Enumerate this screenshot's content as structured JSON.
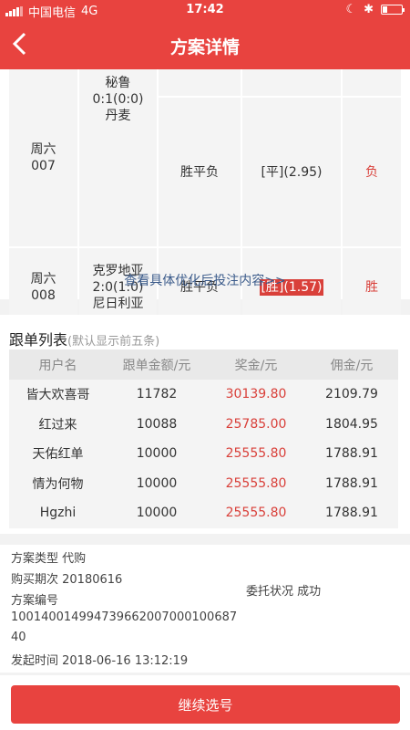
{
  "status_bar": {
    "carrier": "中国电信",
    "network": "4G",
    "time": "17:42"
  },
  "nav": {
    "title": "方案详情"
  },
  "matches": [
    {
      "day": "周六",
      "num": "007",
      "home": "秘鲁",
      "score": "0:1(0:0)",
      "away": "丹麦",
      "play": "胜平负",
      "pick_label": "[平]",
      "pick_odds": "(2.95)",
      "result": "负",
      "pick_highlight": false
    },
    {
      "day": "周六",
      "num": "008",
      "home": "克罗地亚",
      "score": "2:0(1:0)",
      "away": "尼日利亚",
      "play": "胜平负",
      "pick_label": "[胜]",
      "pick_odds": "(1.57)",
      "result": "胜",
      "pick_highlight": true
    }
  ],
  "see_more_link": "查看具体优化后投注内容>>",
  "follow": {
    "title": "跟单列表",
    "subtitle": "(默认显示前五条)",
    "headers": [
      "用户名",
      "跟单金额/元",
      "奖金/元",
      "佣金/元"
    ],
    "rows": [
      [
        "皆大欢喜哥",
        "11782",
        "30139.80",
        "2109.79"
      ],
      [
        "红过来",
        "10088",
        "25785.00",
        "1804.95"
      ],
      [
        "天佑红单",
        "10000",
        "25555.80",
        "1788.91"
      ],
      [
        "情为何物",
        "10000",
        "25555.80",
        "1788.91"
      ],
      [
        "Hgzhi",
        "10000",
        "25555.80",
        "1788.91"
      ]
    ]
  },
  "info": {
    "type_line": "方案类型 代购",
    "period_line": "购买期次 20180616",
    "entrust_line": "委托状况  成功",
    "number_label": "方案编号",
    "number_part1": "100140014994739662007000100687",
    "number_part2": "40",
    "time_line": "发起时间   2018-06-16 13:12:19"
  },
  "bottom": {
    "button": "继续选号"
  },
  "colors": {
    "brand_red": "#e8433f",
    "win_red": "#d9403a",
    "link_blue": "#3a5a8a"
  }
}
